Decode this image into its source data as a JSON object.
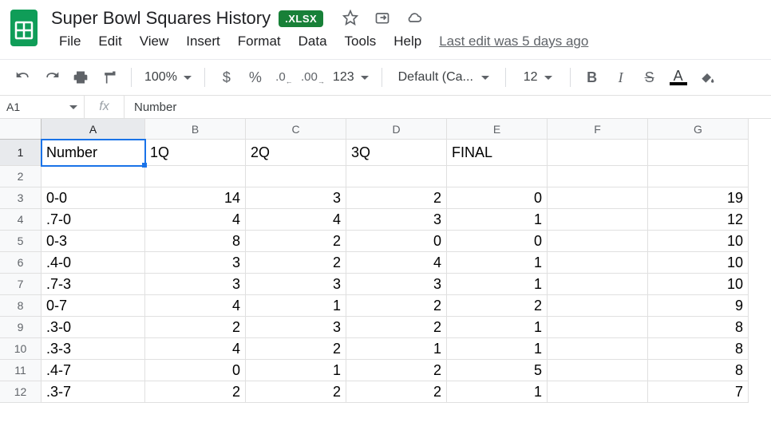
{
  "doc": {
    "title": "Super Bowl Squares History",
    "badge": ".XLSX",
    "last_edit": "Last edit was 5 days ago"
  },
  "menus": [
    "File",
    "Edit",
    "View",
    "Insert",
    "Format",
    "Data",
    "Tools",
    "Help"
  ],
  "toolbar": {
    "zoom": "100%",
    "font": "Default (Ca...",
    "font_size": "12",
    "more_formats": "123"
  },
  "name_box": "A1",
  "fx_label": "fx",
  "formula": "Number",
  "columns": [
    "A",
    "B",
    "C",
    "D",
    "E",
    "F",
    "G"
  ],
  "chart_data": {
    "type": "table",
    "headers": [
      "Number",
      "1Q",
      "2Q",
      "3Q",
      "FINAL",
      "",
      "G"
    ],
    "rows": [
      {
        "label": "0-0",
        "q1": 14,
        "q2": 3,
        "q3": 2,
        "final": 0,
        "g": 19
      },
      {
        "label": ".7-0",
        "q1": 4,
        "q2": 4,
        "q3": 3,
        "final": 1,
        "g": 12
      },
      {
        "label": "0-3",
        "q1": 8,
        "q2": 2,
        "q3": 0,
        "final": 0,
        "g": 10
      },
      {
        "label": ".4-0",
        "q1": 3,
        "q2": 2,
        "q3": 4,
        "final": 1,
        "g": 10
      },
      {
        "label": ".7-3",
        "q1": 3,
        "q2": 3,
        "q3": 3,
        "final": 1,
        "g": 10
      },
      {
        "label": "0-7",
        "q1": 4,
        "q2": 1,
        "q3": 2,
        "final": 2,
        "g": 9
      },
      {
        "label": ".3-0",
        "q1": 2,
        "q2": 3,
        "q3": 2,
        "final": 1,
        "g": 8
      },
      {
        "label": ".3-3",
        "q1": 4,
        "q2": 2,
        "q3": 1,
        "final": 1,
        "g": 8
      },
      {
        "label": ".4-7",
        "q1": 0,
        "q2": 1,
        "q3": 2,
        "final": 5,
        "g": 8
      },
      {
        "label": ".3-7",
        "q1": 2,
        "q2": 2,
        "q3": 2,
        "final": 1,
        "g": 7
      }
    ]
  }
}
